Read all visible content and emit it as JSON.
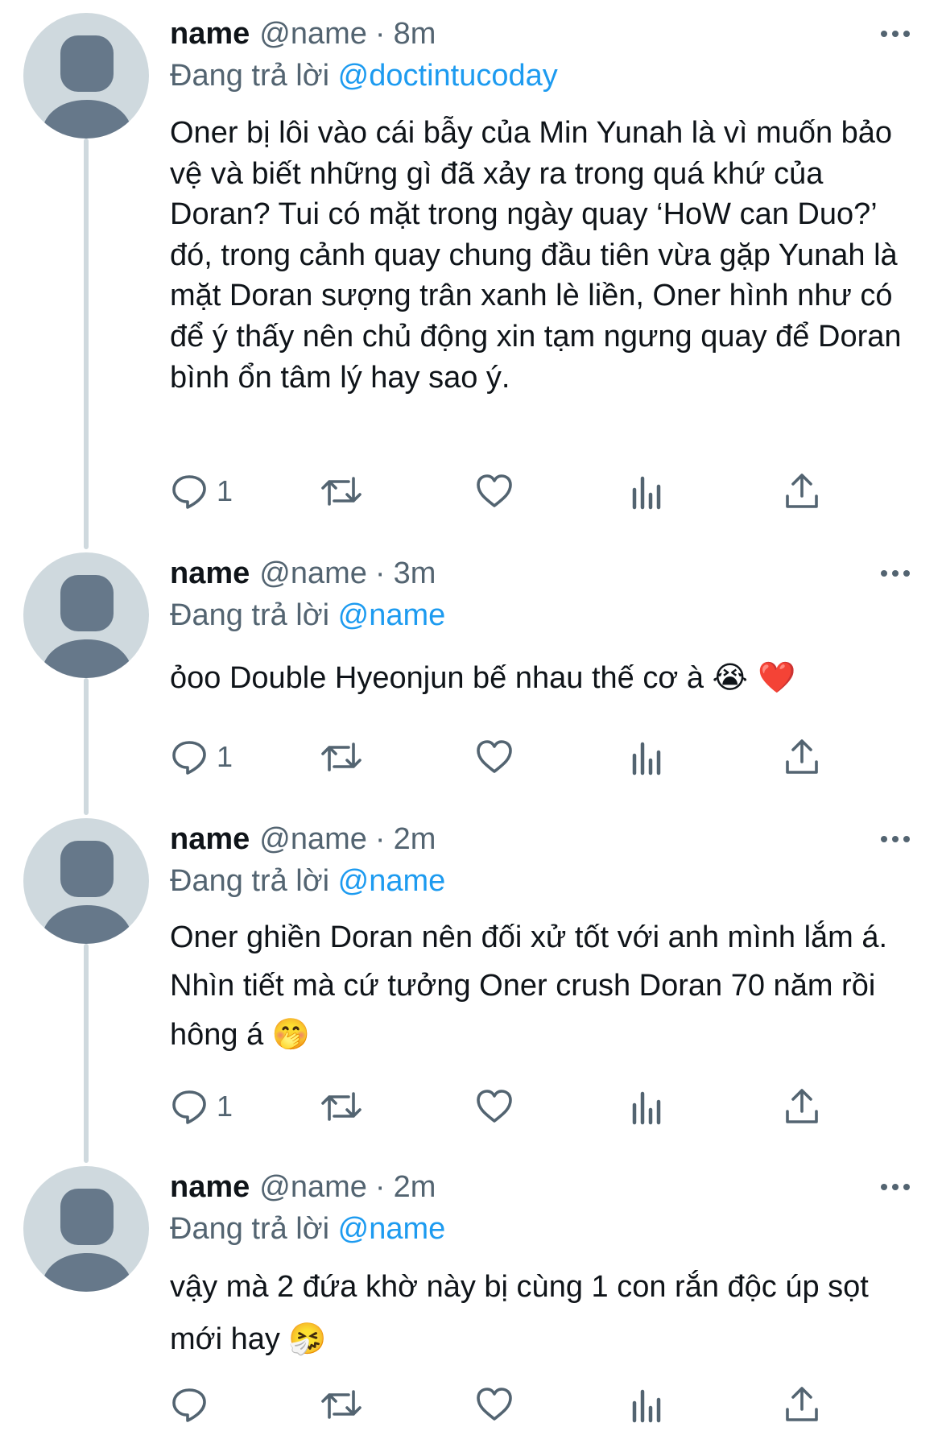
{
  "icons": {
    "reply": "reply-icon",
    "retweet": "retweet-icon",
    "like": "heart-icon",
    "stats": "analytics-icon",
    "share": "share-icon",
    "more": "more-icon"
  },
  "colors": {
    "text": "#0f1419",
    "secondary": "#536471",
    "mention": "#1d9bf0",
    "thread_line": "#cfd9de",
    "avatar_bg": "#cfd9de",
    "avatar_fg": "#66788a"
  },
  "tweets": [
    {
      "name": "name",
      "handle": "@name",
      "separator": "·",
      "time": "8m",
      "reply_prefix": "Đang trả lời",
      "reply_to": "@doctintucoday",
      "text": "Oner bị lôi vào cái bẫy của Min Yunah là vì muốn bảo vệ và biết những gì đã xảy ra trong quá khứ của Doran? Tui có mặt trong ngày quay ‘HoW can Duo?’ đó, trong cảnh quay chung đầu tiên vừa gặp Yunah là mặt Doran sượng trân xanh lè liền, Oner hình như có để ý thấy nên chủ động xin tạm ngưng quay để Doran bình ổn tâm lý hay sao ý.",
      "emoji": "",
      "reply_count": "1"
    },
    {
      "name": "name",
      "handle": "@name",
      "separator": "·",
      "time": "3m",
      "reply_prefix": "Đang trả lời",
      "reply_to": "@name",
      "text": "ỏoo Double Hyeonjun bế nhau thế cơ à ",
      "emoji": "😭 ❤️",
      "reply_count": "1"
    },
    {
      "name": "name",
      "handle": "@name",
      "separator": "·",
      "time": "2m",
      "reply_prefix": "Đang trả lời",
      "reply_to": "@name",
      "text": "Oner ghiền Doran nên đối xử tốt với anh mình lắm á. Nhìn tiết mà cứ tưởng Oner crush Doran 70 năm rồi hông á ",
      "emoji": "🤭",
      "reply_count": "1"
    },
    {
      "name": "name",
      "handle": "@name",
      "separator": "·",
      "time": "2m",
      "reply_prefix": "Đang trả lời",
      "reply_to": "@name",
      "text": "vậy mà 2 đứa khờ này bị cùng 1 con rắn độc úp sọt mới hay ",
      "emoji": "🤧",
      "reply_count": ""
    }
  ]
}
